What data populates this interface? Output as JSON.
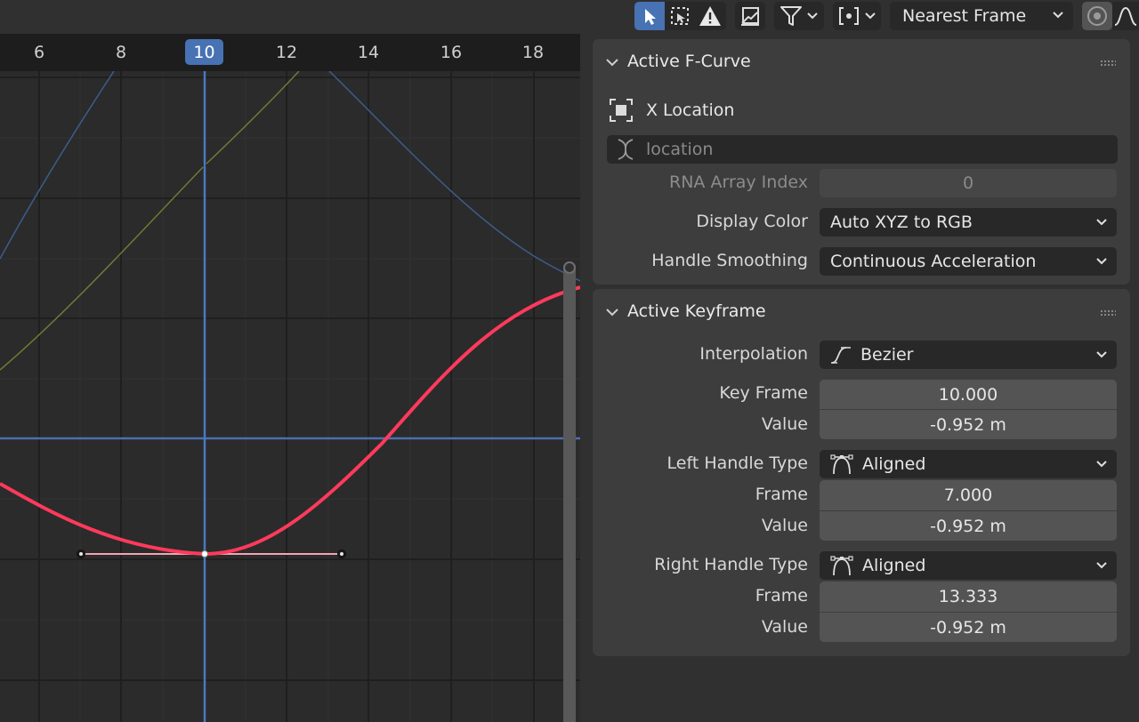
{
  "header": {
    "snap_mode": "Nearest Frame",
    "icons": [
      "select-tool-icon",
      "box-select-icon",
      "warning-icon",
      "normalize-icon",
      "filter-icon",
      "pivot-point-icon",
      "proportional-editing-icon",
      "falloff-curve-icon"
    ]
  },
  "timeline": {
    "tick_labels": [
      "6",
      "8",
      "10",
      "12",
      "14",
      "16",
      "18"
    ],
    "current_frame": "10"
  },
  "colors": {
    "accent": "#4772b3",
    "x_curve": "#ff3a5c",
    "y_curve": "#7f8a3a",
    "z_curve": "#3d5d8a",
    "panel_bg": "#3d3d3d",
    "field_bg": "#545454"
  },
  "sidebar": {
    "active_fcurve": {
      "title": "Active F-Curve",
      "curve_name": "X Location",
      "data_path": "location",
      "rna_array_index_label": "RNA Array Index",
      "rna_array_index_value": "0",
      "display_color_label": "Display Color",
      "display_color_value": "Auto XYZ to RGB",
      "handle_smoothing_label": "Handle Smoothing",
      "handle_smoothing_value": "Continuous Acceleration"
    },
    "active_keyframe": {
      "title": "Active Keyframe",
      "interpolation_label": "Interpolation",
      "interpolation_value": "Bezier",
      "key_frame_label": "Key Frame",
      "key_frame_value": "10.000",
      "value_label": "Value",
      "value_value": "-0.952 m",
      "left_handle_type_label": "Left Handle Type",
      "left_handle_type_value": "Aligned",
      "left_frame_label": "Frame",
      "left_frame_value": "7.000",
      "left_value_label": "Value",
      "left_value_value": "-0.952 m",
      "right_handle_type_label": "Right Handle Type",
      "right_handle_type_value": "Aligned",
      "right_frame_label": "Frame",
      "right_frame_value": "13.333",
      "right_value_label": "Value",
      "right_value_value": "-0.952 m"
    }
  }
}
